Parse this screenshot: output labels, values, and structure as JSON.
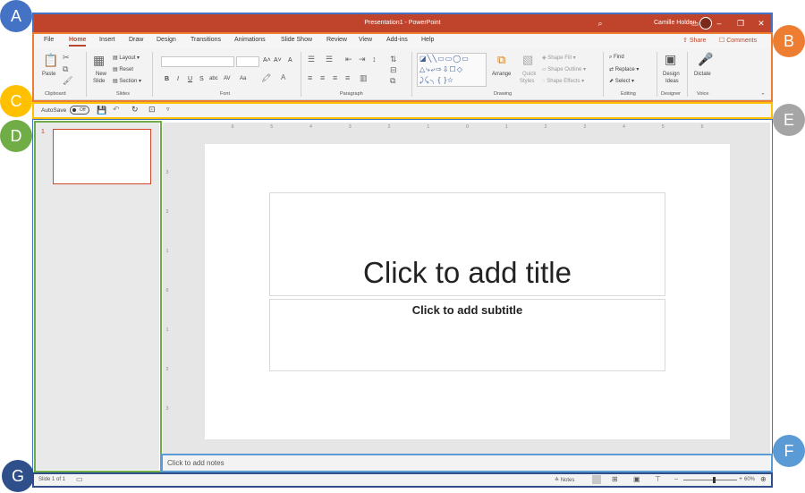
{
  "titlebar": {
    "title": "Presentation1  -  PowerPoint",
    "user": "Camille Holden",
    "search_icon": "search-icon",
    "ribbon_display_icon": "ribbon-display-icon",
    "minimize_icon": "minimize-icon",
    "restore_icon": "restore-icon",
    "close_icon": "close-icon"
  },
  "tabs": [
    "File",
    "Home",
    "Insert",
    "Draw",
    "Design",
    "Transitions",
    "Animations",
    "Slide Show",
    "Review",
    "View",
    "Add-ins",
    "Help"
  ],
  "active_tab": "Home",
  "share_label": "Share",
  "comments_label": "Comments",
  "ribbon": {
    "clipboard": {
      "paste": "Paste",
      "label": "Clipboard"
    },
    "slides": {
      "new_slide_1": "New",
      "new_slide_2": "Slide",
      "layout": "Layout",
      "reset": "Reset",
      "section": "Section",
      "label": "Slides"
    },
    "font": {
      "label": "Font",
      "bold": "B",
      "italic": "I",
      "underline": "U",
      "strike": "S",
      "shadow": "abc",
      "spacing": "AV",
      "case": "Aa",
      "grow": "A˄",
      "shrink": "A˅",
      "clear": "A"
    },
    "paragraph": {
      "label": "Paragraph"
    },
    "drawing": {
      "label": "Drawing",
      "arrange": "Arrange",
      "quick_styles_1": "Quick",
      "quick_styles_2": "Styles",
      "shape_fill": "Shape Fill",
      "shape_outline": "Shape Outline",
      "shape_effects": "Shape Effects"
    },
    "editing": {
      "label": "Editing",
      "find": "Find",
      "replace": "Replace",
      "select": "Select"
    },
    "designer": {
      "label": "Designer",
      "design_ideas_1": "Design",
      "design_ideas_2": "Ideas"
    },
    "voice": {
      "label": "Voice",
      "dictate": "Dictate"
    }
  },
  "qat": {
    "autosave": "AutoSave",
    "toggle": "Off"
  },
  "slides_pane": {
    "slide_number": "1"
  },
  "slide": {
    "title_placeholder": "Click to add title",
    "subtitle_placeholder": "Click to add subtitle"
  },
  "notes": {
    "placeholder": "Click to add notes"
  },
  "status": {
    "slide_info": "Slide 1 of 1",
    "notes_label": "Notes",
    "zoom": "60%"
  },
  "ruler_h_ticks": [
    "6",
    "5",
    "4",
    "3",
    "2",
    "1",
    "0",
    "1",
    "2",
    "3",
    "4",
    "5",
    "6"
  ],
  "ruler_v_ticks": [
    "3",
    "2",
    "1",
    "0",
    "1",
    "2",
    "3"
  ],
  "callouts": {
    "A": {
      "letter": "A",
      "color": "#4472c4"
    },
    "B": {
      "letter": "B",
      "color": "#ed7d31"
    },
    "C": {
      "letter": "C",
      "color": "#ffc000"
    },
    "D": {
      "letter": "D",
      "color": "#70ad47"
    },
    "E": {
      "letter": "E",
      "color": "#a5a5a5"
    },
    "F": {
      "letter": "F",
      "color": "#5b9bd5"
    },
    "G": {
      "letter": "G",
      "color": "#2f4f8a"
    }
  },
  "colors": {
    "accent": "#b8472c",
    "titlebar": "#c0432b",
    "frame_blue": "#4472c4",
    "frame_orange": "#ed7d31",
    "frame_yellow": "#ffc000",
    "frame_green": "#70ad47"
  }
}
